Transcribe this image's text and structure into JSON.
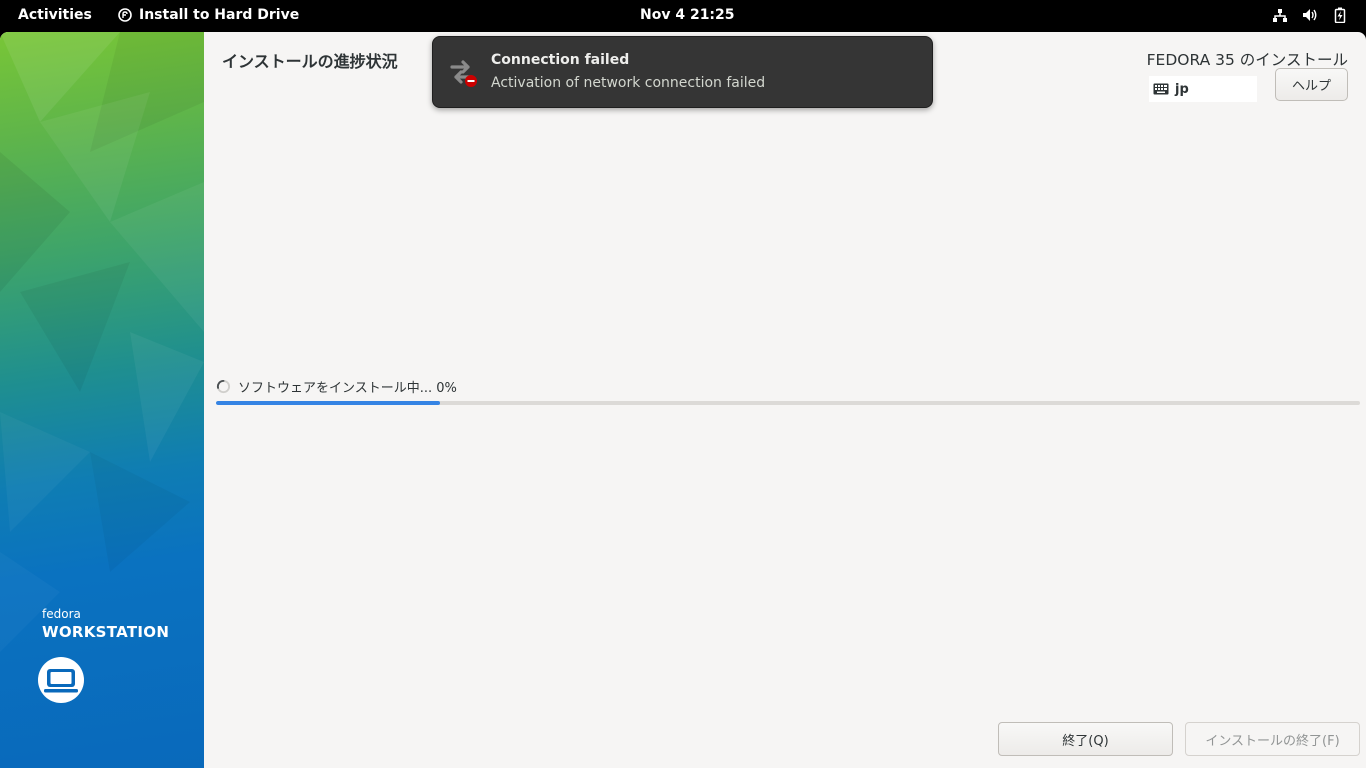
{
  "topbar": {
    "activities": "Activities",
    "app_name": "Install to Hard Drive",
    "clock": "Nov 4  21:25",
    "tray_icons": [
      "network-wired-icon",
      "volume-icon",
      "battery-charging-icon"
    ]
  },
  "sidebar": {
    "brand_small": "fedora",
    "brand_big": "WORKSTATION"
  },
  "header": {
    "page_title": "インストールの進捗状況",
    "product_title": "FEDORA 35 のインストール",
    "keyboard_layout": "jp",
    "help_label": "ヘルプ"
  },
  "progress": {
    "status_text": "ソフトウェアをインストール中... 0%",
    "fill_fraction": 0.196
  },
  "buttons": {
    "quit": "終了(Q)",
    "finish": "インストールの終了(F)"
  },
  "notification": {
    "title": "Connection failed",
    "body": "Activation of network connection failed",
    "icon": "network-transmit-error-icon"
  },
  "colors": {
    "accent": "#3584e4",
    "notification_bg": "#353535",
    "window_bg": "#f6f5f4",
    "error_red": "#cc0000"
  }
}
